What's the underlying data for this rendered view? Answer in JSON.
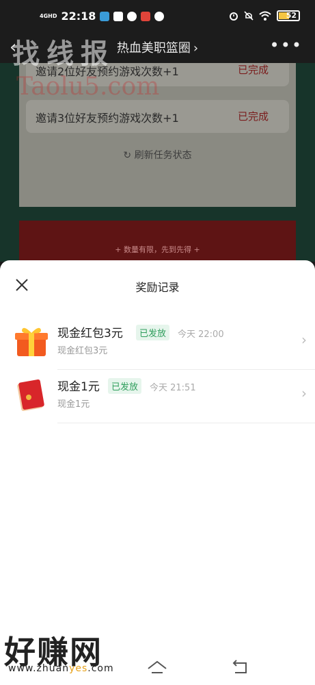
{
  "status_bar": {
    "network": "4GHD",
    "time": "22:18",
    "battery": "52"
  },
  "nav": {
    "back_icon": "chevron-left-icon",
    "title": "热血美职篮圈",
    "title_chevron": "›",
    "more_icon": "more-dots-icon"
  },
  "background": {
    "tasks": [
      {
        "label": "邀请2位好友预约游戏次数+1",
        "status": "已完成"
      },
      {
        "label": "邀请3位好友预约游戏次数+1",
        "status": "已完成"
      }
    ],
    "refresh_label": "刷新任务状态",
    "envelope_caption": "+ 数量有限，先到先得 +"
  },
  "watermarks": {
    "top_cn": "找线报",
    "top_en": "Taolu5.com",
    "bottom_cn": "好赚网",
    "bottom_url_a": "www.zhuan",
    "bottom_url_b": "yes",
    "bottom_url_c": ".com"
  },
  "sheet": {
    "title": "奖励记录",
    "close_icon": "close-icon",
    "records": [
      {
        "icon": "gift-box-icon",
        "name": "现金红包3元",
        "badge": "已发放",
        "time": "今天 22:00",
        "sub": "现金红包3元"
      },
      {
        "icon": "red-envelope-icon",
        "name": "现金1元",
        "badge": "已发放",
        "time": "今天 21:51",
        "sub": "现金1元"
      }
    ]
  },
  "system_nav": {
    "home_icon": "home-icon",
    "back_icon": "back-icon"
  },
  "colors": {
    "badge_green": "#2f9e5c",
    "status_red": "#7a1c1c"
  }
}
